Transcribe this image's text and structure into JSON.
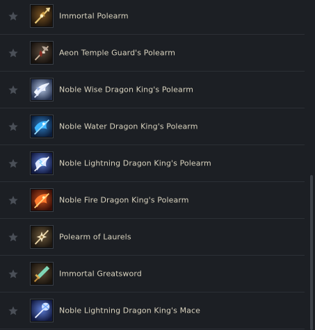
{
  "colors": {
    "background": "#1c1f24",
    "divider": "#2c3036",
    "text": "#d9d3bf",
    "star": "#4a4f57",
    "scrollbar": "#3c4148"
  },
  "items": [
    {
      "name": "Immortal Polearm",
      "icon": "golden-polearm-icon",
      "favorited": false
    },
    {
      "name": "Aeon Temple Guard's Polearm",
      "icon": "dark-axe-polearm-icon",
      "favorited": false
    },
    {
      "name": "Noble Wise Dragon King's Polearm",
      "icon": "white-dragon-polearm-icon",
      "favorited": false
    },
    {
      "name": "Noble Water Dragon King's Polearm",
      "icon": "water-dragon-polearm-icon",
      "favorited": false
    },
    {
      "name": "Noble Lightning Dragon King's Polearm",
      "icon": "lightning-dragon-polearm-icon",
      "favorited": false
    },
    {
      "name": "Noble Fire Dragon King's Polearm",
      "icon": "fire-dragon-polearm-icon",
      "favorited": false
    },
    {
      "name": "Polearm of Laurels",
      "icon": "laurel-polearm-icon",
      "favorited": false
    },
    {
      "name": "Immortal Greatsword",
      "icon": "jade-greatsword-icon",
      "favorited": false
    },
    {
      "name": "Noble Lightning Dragon King's Mace",
      "icon": "lightning-dragon-mace-icon",
      "favorited": false
    }
  ]
}
